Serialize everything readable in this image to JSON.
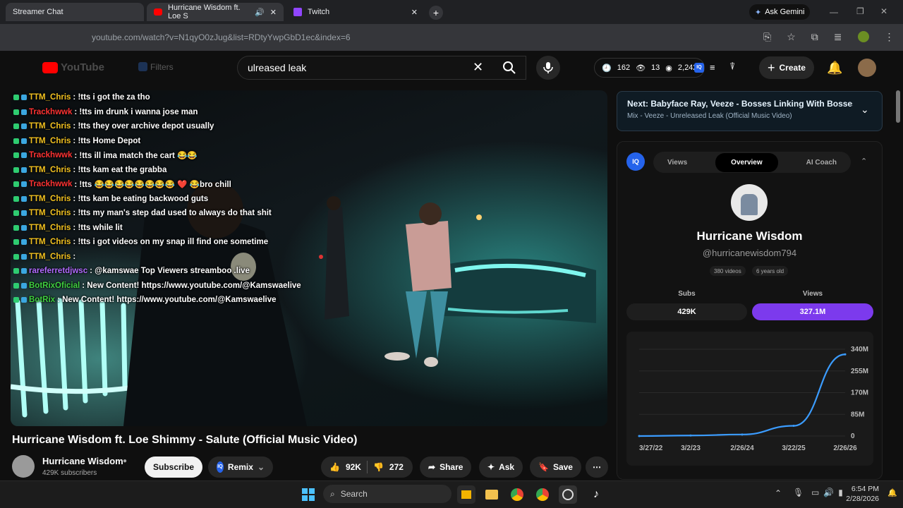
{
  "browser": {
    "tabs": [
      {
        "label": "Streamer Chat"
      },
      {
        "label": "Hurricane Wisdom ft. Loe S"
      },
      {
        "label": "Twitch"
      }
    ],
    "url": "youtube.com/watch?v=N1qyO0zJug&list=RDtyYwpGbD1ec&index=6",
    "gemini_label": "Ask Gemini"
  },
  "youtube": {
    "search_value": "ulreased leak",
    "logo_label": "YouTube",
    "filter_label": "Filters",
    "stats": {
      "views": "162",
      "eye": "13",
      "count": "2,242"
    },
    "create_label": "Create",
    "video_title": "Hurricane Wisdom ft. Loe Shimmy - Salute (Official Music Video)",
    "channel_name": "Hurricane Wisdom",
    "subscribers": "429K subscribers",
    "subscribe_label": "Subscribe",
    "remix_label": "Remix",
    "likes": "92K",
    "dislikes": "272",
    "share_label": "Share",
    "ask_label": "Ask",
    "save_label": "Save"
  },
  "chat": [
    {
      "user": "TTM_Chris",
      "color": "#f0c020",
      "msg": ": !tts i got the za tho"
    },
    {
      "user": "Trackhwwk",
      "color": "#ff3333",
      "msg": ": !tts im drunk i wanna jose man"
    },
    {
      "user": "TTM_Chris",
      "color": "#f0c020",
      "msg": ": !tts they over archive depot usually"
    },
    {
      "user": "TTM_Chris",
      "color": "#f0c020",
      "msg": ": !tts Home Depot"
    },
    {
      "user": "Trackhwwk",
      "color": "#ff3333",
      "msg": ": !tts ill ima match the cart 😂😂"
    },
    {
      "user": "TTM_Chris",
      "color": "#f0c020",
      "msg": ": !tts kam eat the grabba"
    },
    {
      "user": "Trackhwwk",
      "color": "#ff3333",
      "msg": ": !tts 😂😂😂😂😂😂😂😂 ❤️ 😂bro chill"
    },
    {
      "user": "TTM_Chris",
      "color": "#f0c020",
      "msg": ": !tts kam be eating backwood guts"
    },
    {
      "user": "TTM_Chris",
      "color": "#f0c020",
      "msg": ": !tts my man's step dad used to always do that shit"
    },
    {
      "user": "TTM_Chris",
      "color": "#f0c020",
      "msg": ": !tts while lit"
    },
    {
      "user": "TTM_Chris",
      "color": "#f0c020",
      "msg": ": !tts i got videos on my snap ill find one sometime"
    },
    {
      "user": "TTM_Chris",
      "color": "#f0c020",
      "msg": ":"
    },
    {
      "user": "rareferretdjwsc",
      "color": "#b26bff",
      "msg": ": @kamswae Top Viewers streamboo .live"
    },
    {
      "user": "BotRixOficial",
      "color": "#40d040",
      "msg": ": New Content! https://www.youtube.com/@Kamswaelive"
    },
    {
      "user": "BotRix",
      "color": "#40d040",
      "msg": ": New Content! https://www.youtube.com/@Kamswaelive"
    }
  ],
  "next_up": {
    "title": "Next: Babyface Ray, Veeze - Bosses Linking With Bosses (O...",
    "subtitle": "Mix - Veeze - Unreleased Leak (Official Music Video)"
  },
  "iq_panel": {
    "tabs": [
      "Views",
      "Overview",
      "AI Coach"
    ],
    "active_tab": "Overview",
    "channel": "Hurricane Wisdom",
    "handle": "@hurricanewisdom794",
    "videos": "380 videos",
    "age": "6 years old",
    "subs_label": "Subs",
    "subs_value": "429K",
    "views_label": "Views",
    "views_value": "327.1M",
    "accent": "#7c3aed"
  },
  "chart_data": {
    "type": "line",
    "x": [
      "3/27/22",
      "3/2/23",
      "2/26/24",
      "3/22/25",
      "2/26/26"
    ],
    "xlabel": "",
    "ylabel": "",
    "ylim": [
      0,
      340
    ],
    "yticks": [
      "0",
      "85M",
      "170M",
      "255M",
      "340M"
    ],
    "series": [
      {
        "color": "#3b9cff",
        "values": [
          0,
          2,
          6,
          40,
          320
        ]
      }
    ]
  },
  "taskbar": {
    "search_label": "Search",
    "time": "6:54 PM",
    "date": "2/28/2026"
  }
}
